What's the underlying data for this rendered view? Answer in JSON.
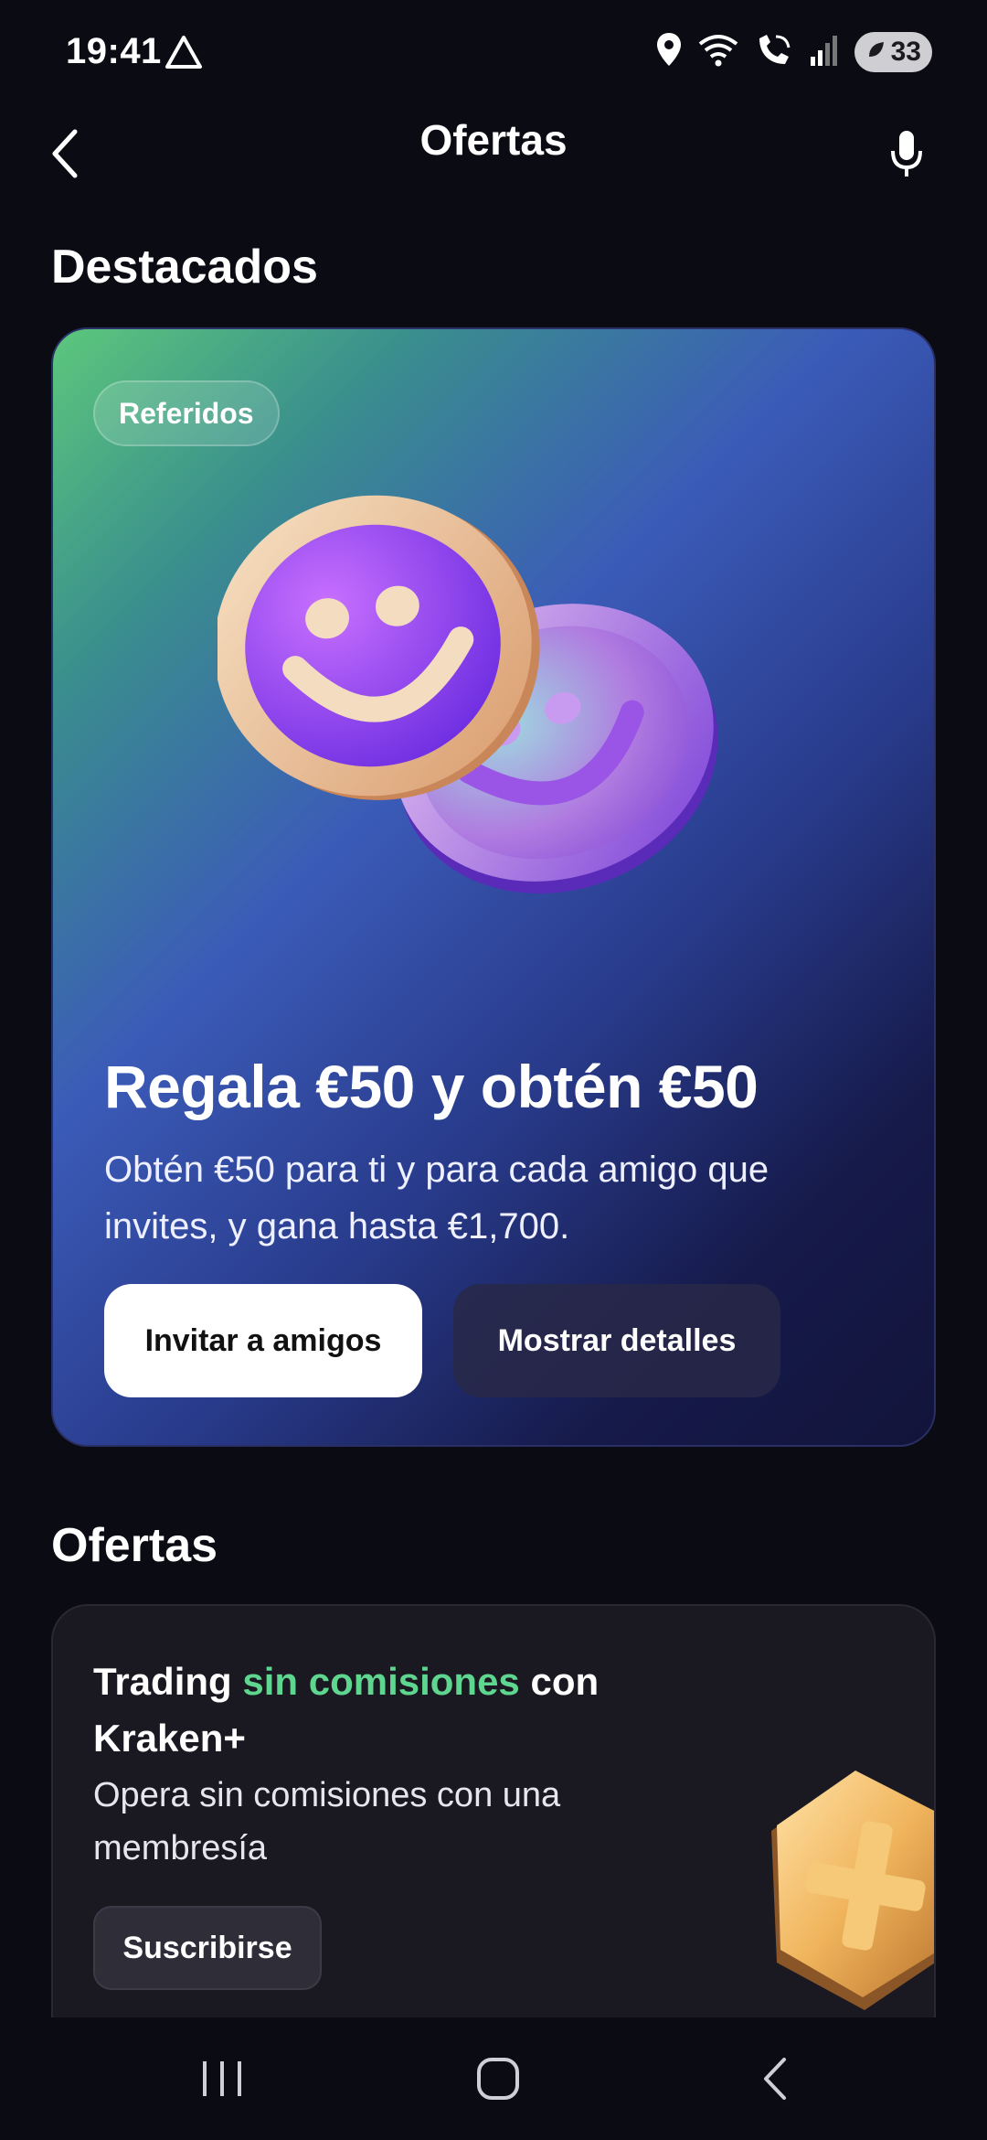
{
  "status_bar": {
    "time": "19:41",
    "battery": "33"
  },
  "header": {
    "title": "Ofertas"
  },
  "featured": {
    "section_title": "Destacados",
    "chip": "Referidos",
    "headline": "Regala €50 y obtén €50",
    "description": "Obtén €50 para ti y para cada amigo que invites, y gana hasta €1,700.",
    "primary_button": "Invitar a amigos",
    "secondary_button": "Mostrar detalles"
  },
  "offers": {
    "section_title": "Ofertas",
    "card": {
      "title_part1": "Trading ",
      "title_accent": "sin comisiones",
      "title_part2": " con Kraken+",
      "description": "Opera sin comisiones con una membresía",
      "button": "Suscribirse"
    }
  },
  "colors": {
    "background": "#0b0b13",
    "accent_green": "#5fd68f",
    "card_dark": "#1a1922"
  },
  "icons": [
    "alert-triangle-icon",
    "location-icon",
    "wifi-icon",
    "wifi-call-icon",
    "signal-icon",
    "back-chevron-icon",
    "microphone-icon",
    "recents-icon",
    "home-icon",
    "back-icon"
  ]
}
